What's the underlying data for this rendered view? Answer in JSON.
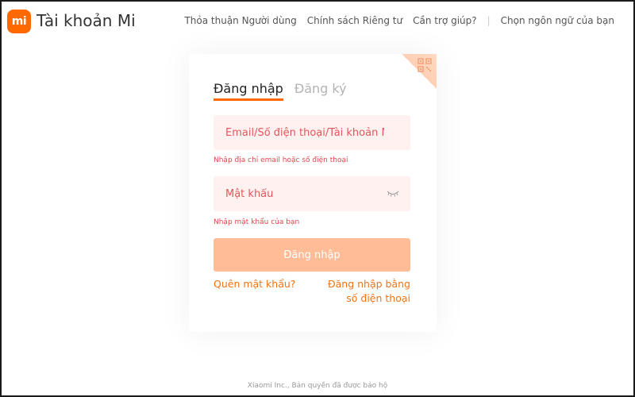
{
  "header": {
    "logo_text": "mi",
    "brand": "Tài khoản Mi",
    "nav": [
      {
        "label": "Thỏa thuận Người dùng"
      },
      {
        "label": "Chính sách Riêng tư"
      },
      {
        "label": "Cần trợ giúp?"
      },
      {
        "label": "Chọn ngôn ngữ của bạn"
      }
    ]
  },
  "card": {
    "tabs": [
      {
        "label": "Đăng nhập",
        "active": true
      },
      {
        "label": "Đăng ký",
        "active": false
      }
    ],
    "email": {
      "placeholder": "Email/Số điện thoại/Tài khoản Mi",
      "value": "",
      "hint": "Nhập địa chỉ email hoặc số điện thoại"
    },
    "password": {
      "placeholder": "Mật khẩu",
      "value": "",
      "hint": "Nhập mật khẩu của bạn"
    },
    "login_button": "Đăng nhập",
    "forgot_link": "Quên mật khẩu?",
    "phone_login_link": "Đăng nhập bằng số điện thoại"
  },
  "footer": "Xiaomi Inc., Bản quyền đã được bảo hộ",
  "colors": {
    "accent": "#ff6900",
    "error": "#e0474c",
    "button_disabled": "#ffbc96",
    "input_bg": "#fef1f0",
    "link": "#f07317"
  },
  "icons": {
    "logo": "xiaomi-logo",
    "qr": "qr-code-icon",
    "eye": "eye-closed-icon"
  }
}
